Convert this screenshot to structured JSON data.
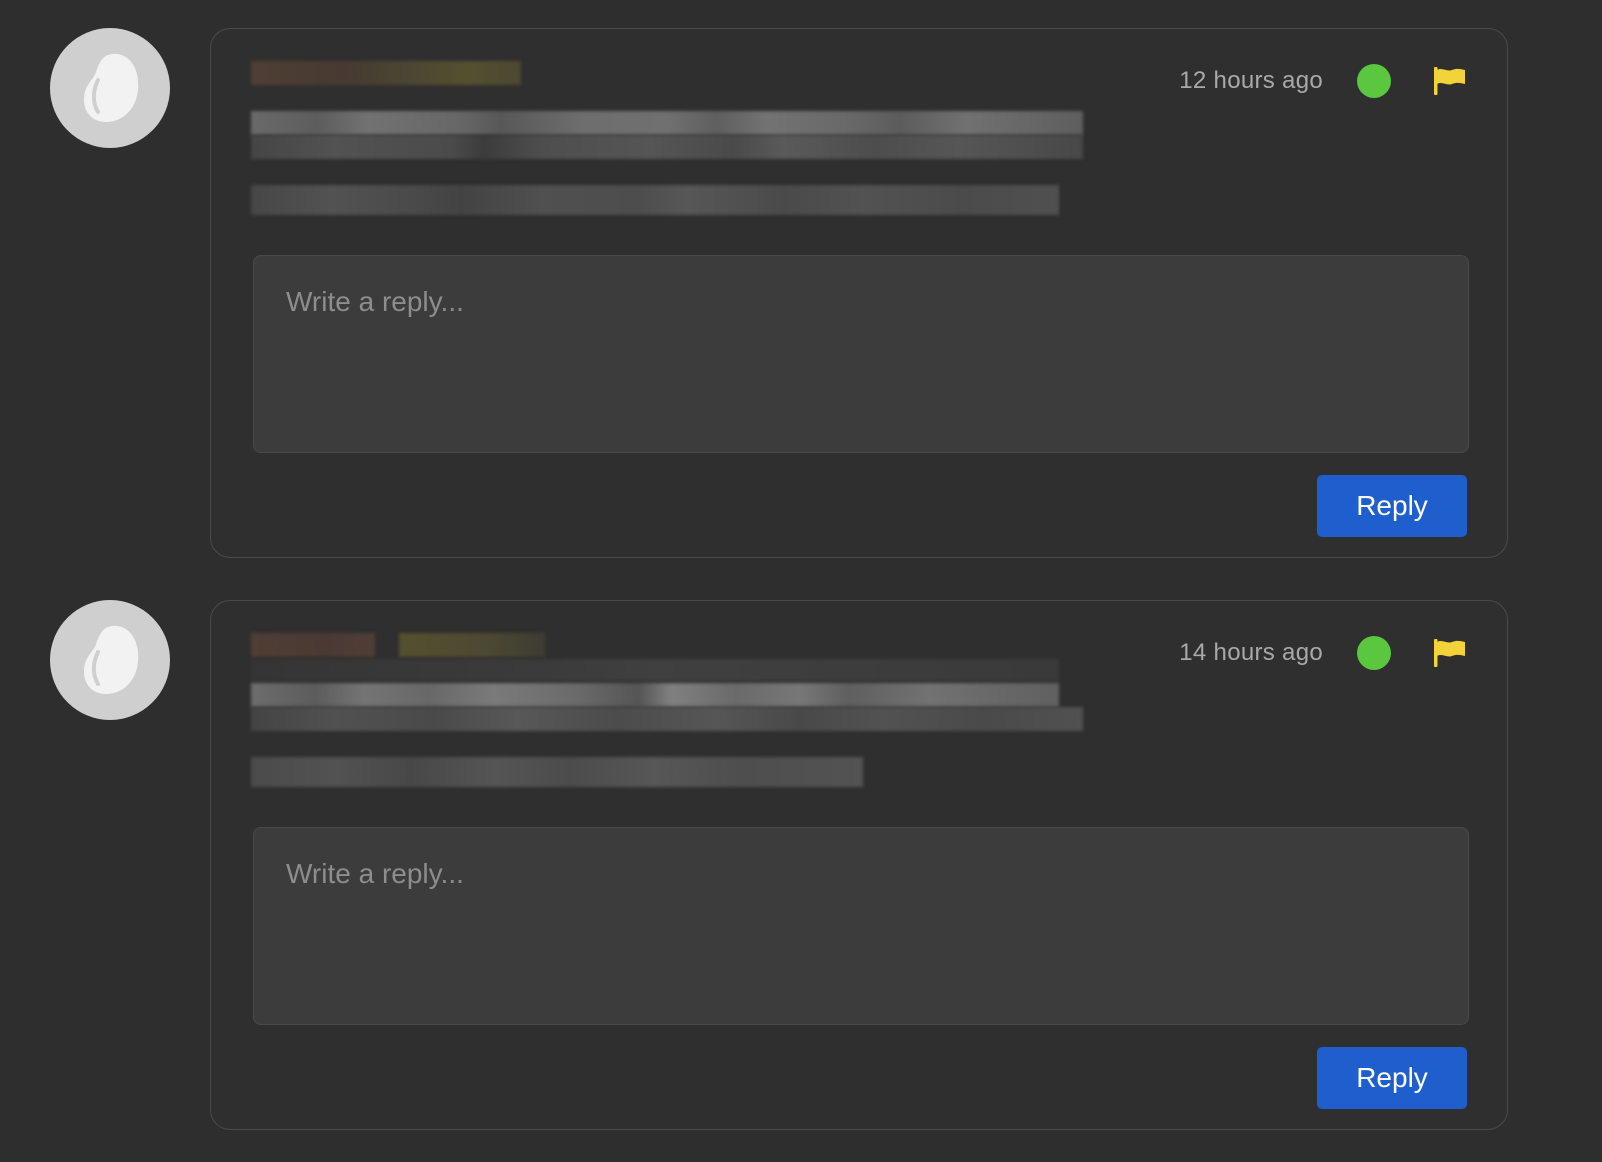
{
  "colors": {
    "background": "#2e2e2e",
    "card_border": "#4a4a4a",
    "status_online": "#5ac73e",
    "flag": "#f3d33a",
    "reply_button": "#1f5fcd"
  },
  "comments": [
    {
      "avatar_icon": "evernote-elephant-icon",
      "timestamp": "12 hours ago",
      "status": "online",
      "flag_icon": "flag-icon",
      "content_redacted": true,
      "reply_placeholder": "Write a reply...",
      "reply_label": "Reply"
    },
    {
      "avatar_icon": "evernote-elephant-icon",
      "timestamp": "14 hours ago",
      "status": "online",
      "flag_icon": "flag-icon",
      "content_redacted": true,
      "reply_placeholder": "Write a reply...",
      "reply_label": "Reply"
    }
  ]
}
